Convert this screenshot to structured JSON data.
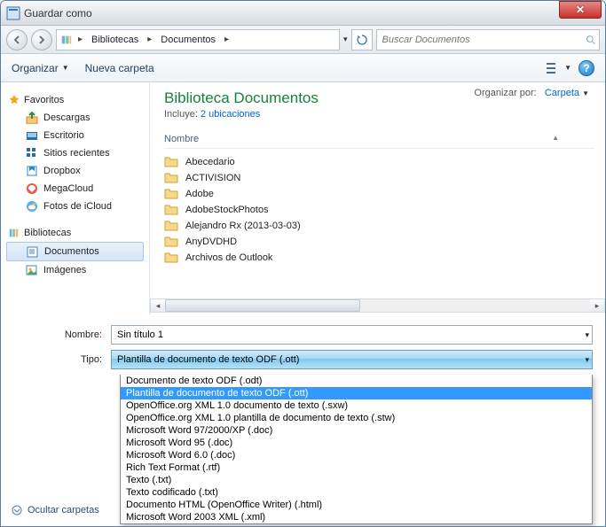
{
  "title": "Guardar como",
  "breadcrumb": {
    "root": " ",
    "lib": "Bibliotecas",
    "doc": "Documentos"
  },
  "search_placeholder": "Buscar Documentos",
  "toolbar": {
    "organize": "Organizar",
    "newfolder": "Nueva carpeta"
  },
  "sidebar": {
    "fav_header": "Favoritos",
    "fav_items": [
      "Descargas",
      "Escritorio",
      "Sitios recientes",
      "Dropbox",
      "MegaCloud",
      "Fotos de iCloud"
    ],
    "lib_header": "Bibliotecas",
    "lib_items": [
      "Documentos",
      "Imágenes"
    ]
  },
  "main": {
    "title": "Biblioteca Documentos",
    "include_label": "Incluye:",
    "include_link": "2 ubicaciones",
    "organize_by_label": "Organizar por:",
    "organize_by_value": "Carpeta",
    "col_name": "Nombre",
    "files": [
      "Abecedario",
      "ACTIVISION",
      "Adobe",
      "AdobeStockPhotos",
      "Alejandro Rx (2013-03-03)",
      "AnyDVDHD",
      "Archivos de Outlook"
    ]
  },
  "form": {
    "name_label": "Nombre:",
    "name_value": "Sin título 1",
    "type_label": "Tipo:",
    "type_value": "Plantilla de documento de texto ODF (.ott)",
    "options": [
      "Documento de texto ODF (.odt)",
      "Plantilla de documento de texto ODF (.ott)",
      "OpenOffice.org XML 1.0 documento de texto (.sxw)",
      "OpenOffice.org XML 1.0 plantilla de documento de texto (.stw)",
      "Microsoft Word 97/2000/XP (.doc)",
      "Microsoft Word 95 (.doc)",
      "Microsoft Word 6.0 (.doc)",
      "Rich Text Format (.rtf)",
      "Texto (.txt)",
      "Texto codificado (.txt)",
      "Documento HTML (OpenOffice Writer) (.html)",
      "Microsoft Word 2003 XML (.xml)"
    ],
    "selected_option_index": 1
  },
  "footer": {
    "hide_folders": "Ocultar carpetas"
  }
}
